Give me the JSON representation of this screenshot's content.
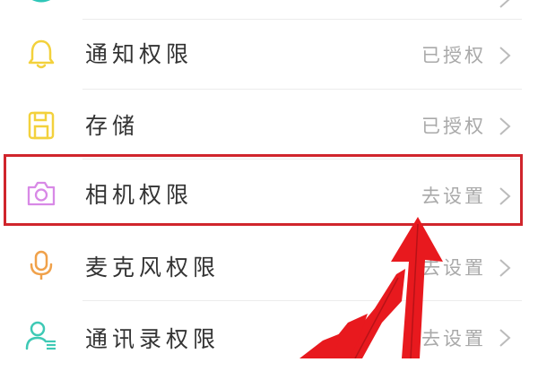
{
  "permissions": {
    "items": [
      {
        "icon": "partial-icon",
        "label": "",
        "status": "",
        "icon_color": "#2ec6b8"
      },
      {
        "icon": "bell-icon",
        "label": "通知权限",
        "status": "已授权",
        "icon_color": "#f3d13c"
      },
      {
        "icon": "storage-icon",
        "label": "存储",
        "status": "已授权",
        "icon_color": "#f3d13c"
      },
      {
        "icon": "camera-icon",
        "label": "相机权限",
        "status": "去设置",
        "icon_color": "#d889e6"
      },
      {
        "icon": "microphone-icon",
        "label": "麦克风权限",
        "status": "去设置",
        "icon_color": "#f0a14a"
      },
      {
        "icon": "contacts-icon",
        "label": "通讯录权限",
        "status": "去设置",
        "icon_color": "#3ec9b5"
      }
    ]
  },
  "annotation": {
    "highlight_color": "#d0252c",
    "arrow_color": "#e8191e"
  }
}
